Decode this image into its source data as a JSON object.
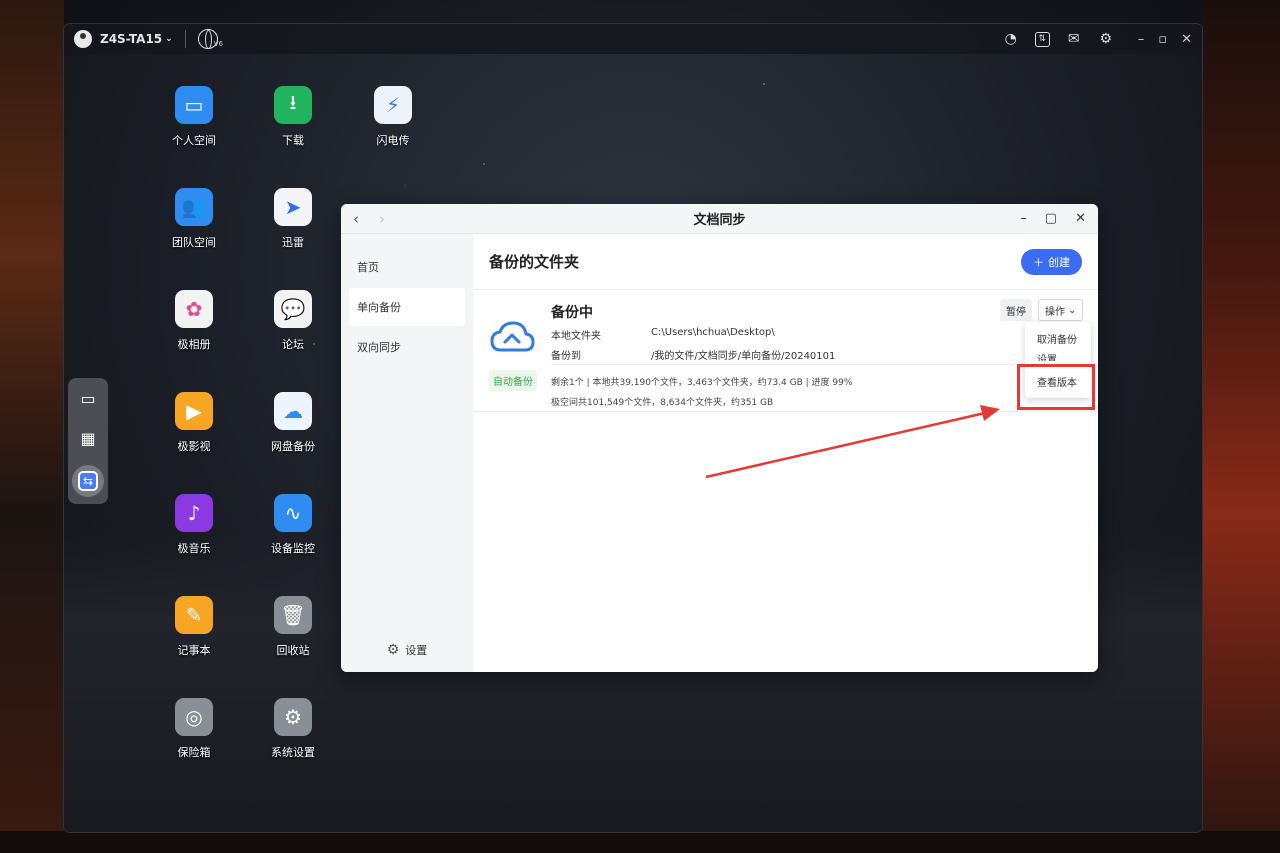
{
  "topbar": {
    "device_name": "Z4S-TA15",
    "globe_badge": "V6",
    "icons": [
      "speedometer-icon",
      "transfer-icon",
      "mail-icon",
      "settings-icon"
    ],
    "window_controls": [
      "minimize-icon",
      "restore-icon",
      "close-icon"
    ]
  },
  "desktop_icons": [
    {
      "label": "个人空间",
      "icon": "folder-icon",
      "color": "#2f8cf0"
    },
    {
      "label": "下载",
      "icon": "download-icon",
      "color": "#22b35e"
    },
    {
      "label": "闪电传",
      "icon": "lightning-icon",
      "color": "#3a7df0"
    },
    {
      "label": "团队空间",
      "icon": "team-folder-icon",
      "color": "#2f8cf0"
    },
    {
      "label": "迅雷",
      "icon": "thunder-bird-icon",
      "color": "#2f6cf0"
    },
    {
      "label": "极相册",
      "icon": "photos-icon",
      "color": "#f3f3f3"
    },
    {
      "label": "论坛",
      "icon": "forum-icon",
      "color": "#f58a1f"
    },
    {
      "label": "极影视",
      "icon": "video-icon",
      "color": "#f6a623"
    },
    {
      "label": "网盘备份",
      "icon": "cloud-backup-icon",
      "color": "#2f8cf0"
    },
    {
      "label": "极音乐",
      "icon": "music-icon",
      "color": "#8a3ae0"
    },
    {
      "label": "设备监控",
      "icon": "monitor-icon",
      "color": "#2f8cf0"
    },
    {
      "label": "记事本",
      "icon": "notepad-icon",
      "color": "#f6a623"
    },
    {
      "label": "回收站",
      "icon": "trash-icon",
      "color": "#8a8e96"
    },
    {
      "label": "保险箱",
      "icon": "safe-icon",
      "color": "#8a8e96"
    },
    {
      "label": "系统设置",
      "icon": "system-settings-icon",
      "color": "#8a8e96"
    }
  ],
  "dock": {
    "items": [
      "desktop-icon",
      "app-grid-icon",
      "sync-app-icon"
    ]
  },
  "app": {
    "title": "文档同步",
    "sidebar": {
      "items": [
        {
          "label": "首页",
          "active": false
        },
        {
          "label": "单向备份",
          "active": true
        },
        {
          "label": "双向同步",
          "active": false
        }
      ],
      "settings_label": "设置"
    },
    "main": {
      "title": "备份的文件夹",
      "create_label": "创建",
      "card": {
        "status": "备份中",
        "badge": "自动备份",
        "local_folder_label": "本地文件夹",
        "local_folder_value": "C:\\Users\\hchua\\Desktop\\",
        "backup_to_label": "备份到",
        "backup_to_value": "/我的文件/文档同步/单向备份/20240101",
        "stat_line_1": "剩余1个 | 本地共39,190个文件，3,463个文件夹，约73.4 GB | 进度 99%",
        "stat_line_2": "极空间共101,549个文件，8,634个文件夹，约351 GB",
        "pause_label": "暂停",
        "ops_label": "操作",
        "menu": {
          "items": [
            "取消备份",
            "设置",
            "查看版本"
          ]
        }
      }
    }
  },
  "colors": {
    "accent": "#3c6cf0",
    "badge_green": "#3aa64a",
    "annotation_red": "#e53935"
  }
}
